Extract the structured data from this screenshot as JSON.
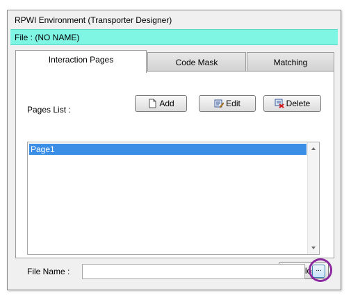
{
  "window": {
    "title": "RPWI Environment (Transporter Designer)"
  },
  "file_bar": {
    "text": "File : (NO NAME)"
  },
  "tabs": [
    {
      "label": "Interaction Pages",
      "active": true
    },
    {
      "label": "Code Mask",
      "active": false
    },
    {
      "label": "Matching",
      "active": false
    }
  ],
  "pages_list": {
    "label": "Pages List :",
    "items": [
      "Page1"
    ],
    "selected_index": 0
  },
  "actions": {
    "add_label": "Add",
    "edit_label": "Edit",
    "delete_label": "Delete"
  },
  "file_name": {
    "label": "File Name :",
    "value": "",
    "placeholder": "",
    "browse_label": "..."
  },
  "footer": {
    "close_label": "Close"
  },
  "colors": {
    "file_bar_bg": "#7ff5e4",
    "selection_bg": "#3a8ee6",
    "highlight_ring": "#8b2a9e"
  }
}
